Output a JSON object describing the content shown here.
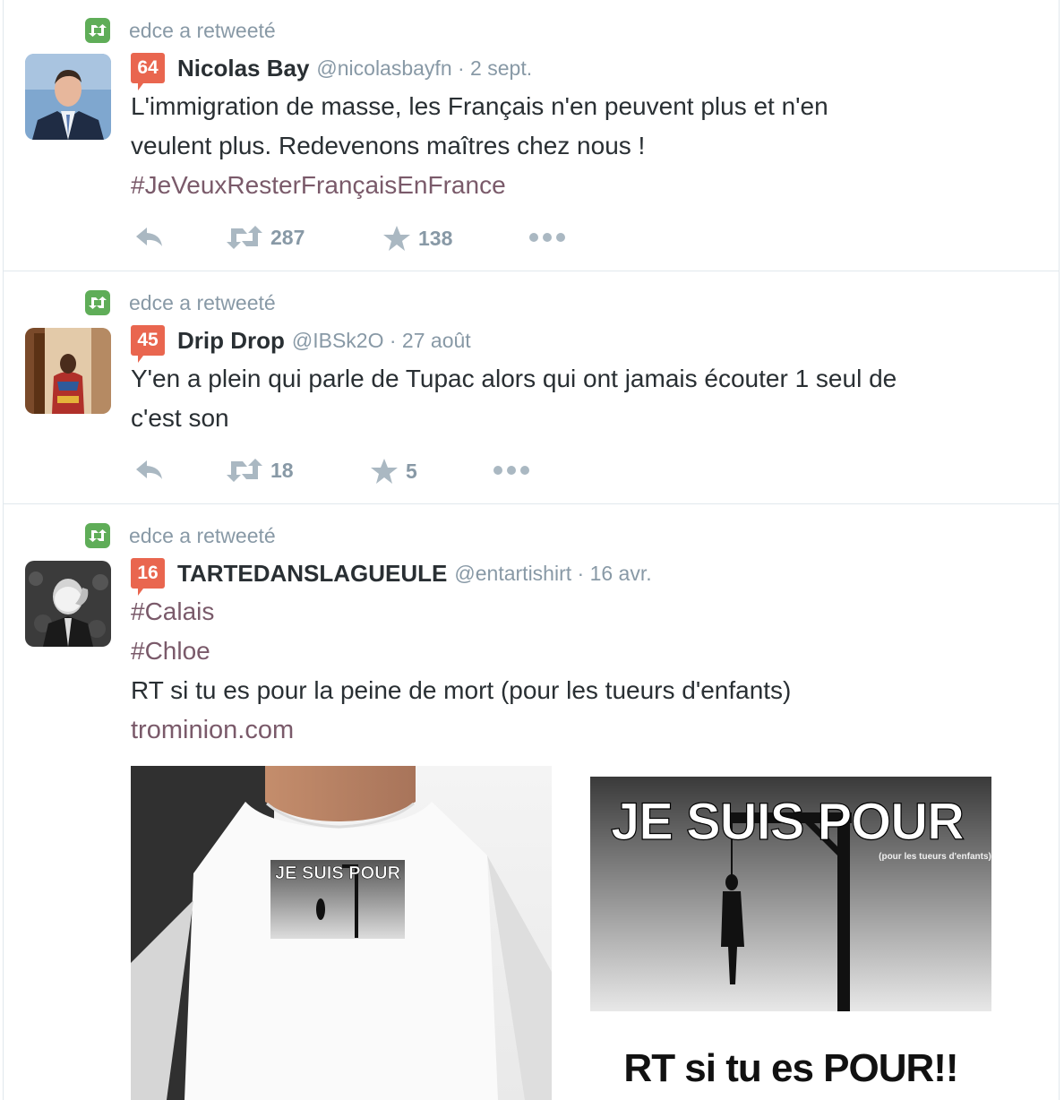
{
  "colors": {
    "retweet_green": "#5fad58",
    "score_red": "#e9664f",
    "meta_gray": "#8899a6",
    "hashtag": "#7a5a6a",
    "text": "#292f33"
  },
  "tweets": [
    {
      "context": "edce a retweeté",
      "score": "64",
      "name": "Nicolas Bay",
      "handle": "@nicolasbayfn · 2 sept.",
      "lines": [
        "L'immigration de masse, les Français n'en peuvent plus et n'en",
        "veulent plus. Redevenons maîtres chez nous !"
      ],
      "hashtags": [
        "#JeVeuxResterFrançaisEnFrance"
      ],
      "retweets": "287",
      "favorites": "138"
    },
    {
      "context": "edce a retweeté",
      "score": "45",
      "name": "Drip Drop",
      "handle": "@IBSk2O · 27 août",
      "lines": [
        "Y'en a plein qui parle de Tupac alors qui ont jamais écouter 1 seul de",
        "c'est son"
      ],
      "retweets": "18",
      "favorites": "5"
    },
    {
      "context": "edce a retweeté",
      "score": "16",
      "name": "TARTEDANSLAGUEULE",
      "handle": "@entartishirt · 16 avr.",
      "hashtags": [
        "#Calais",
        "#Chloe"
      ],
      "lines": [
        "RT si tu es pour la peine de mort (pour les tueurs d'enfants)"
      ],
      "link": "trominion.com",
      "media": {
        "shirt_print": "JE SUIS POUR",
        "poster_title": "JE SUIS POUR",
        "poster_subtitle": "(pour les tueurs d'enfants)",
        "poster_footer": "RT si tu es POUR!!"
      }
    }
  ]
}
